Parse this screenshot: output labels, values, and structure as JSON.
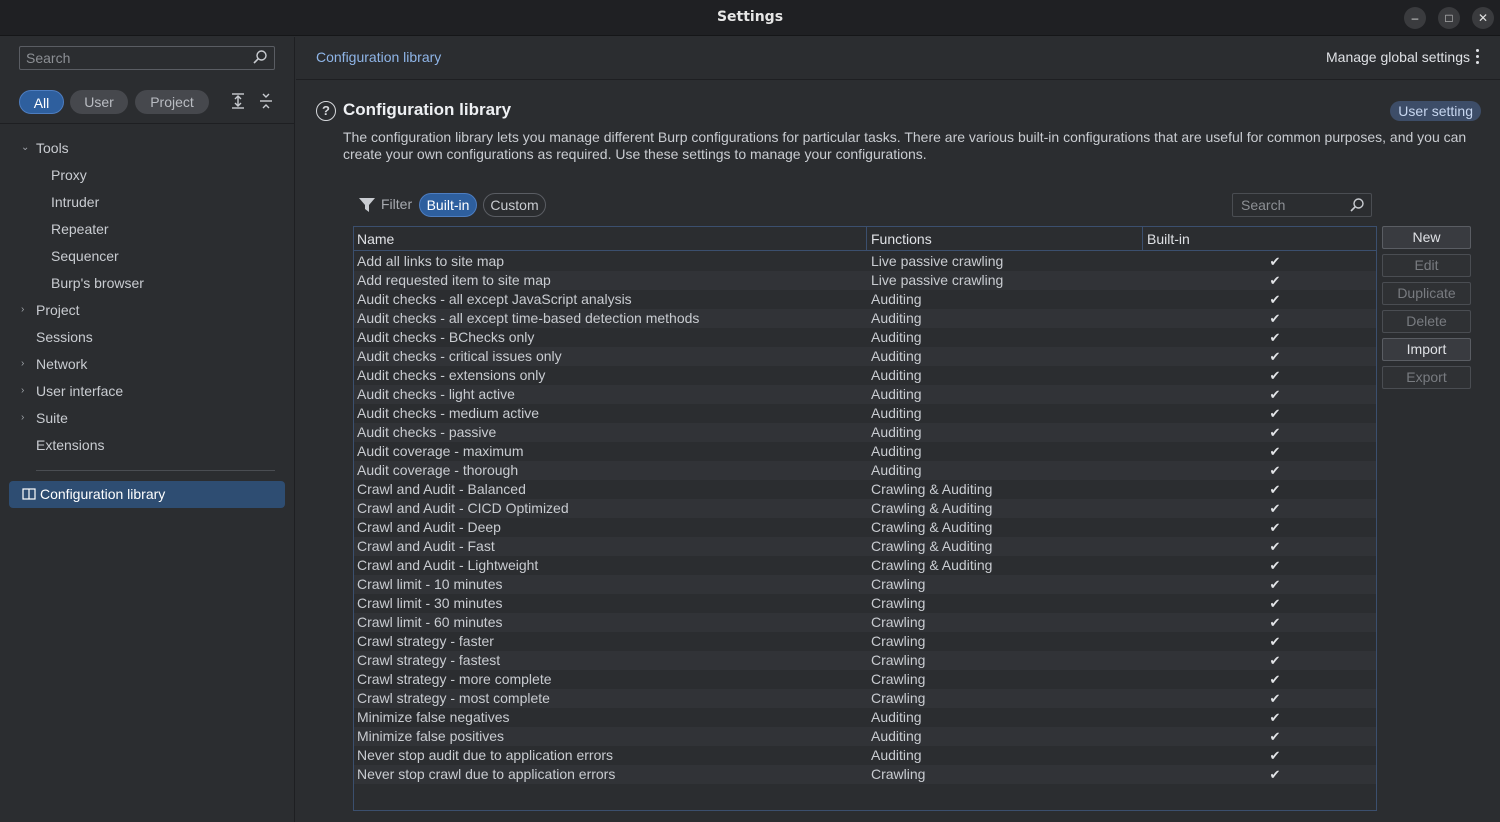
{
  "window": {
    "title": "Settings"
  },
  "sidebar": {
    "search_placeholder": "Search",
    "filters": {
      "all": "All",
      "user": "User",
      "project": "Project"
    },
    "tree": [
      {
        "label": "Tools",
        "expanded": true
      },
      {
        "label": "Proxy"
      },
      {
        "label": "Intruder"
      },
      {
        "label": "Repeater"
      },
      {
        "label": "Sequencer"
      },
      {
        "label": "Burp's browser"
      },
      {
        "label": "Project",
        "expandable": true
      },
      {
        "label": "Sessions"
      },
      {
        "label": "Network",
        "expandable": true
      },
      {
        "label": "User interface",
        "expandable": true
      },
      {
        "label": "Suite",
        "expandable": true
      },
      {
        "label": "Extensions"
      }
    ],
    "selected": "Configuration library"
  },
  "header": {
    "breadcrumb": "Configuration library",
    "manage_global": "Manage global settings"
  },
  "section": {
    "title": "Configuration library",
    "badge": "User setting",
    "description": "The configuration library lets you manage different Burp configurations for particular tasks. There are various built-in configurations that are useful for common purposes, and you can create your own configurations as required. Use these settings to manage your configurations."
  },
  "filter": {
    "label": "Filter",
    "builtin": "Built-in",
    "custom": "Custom",
    "search_placeholder": "Search"
  },
  "table": {
    "columns": [
      "Name",
      "Functions",
      "Built-in"
    ],
    "check": "✔",
    "rows": [
      [
        "Add all links to site map",
        "Live passive crawling"
      ],
      [
        "Add requested item to site map",
        "Live passive crawling"
      ],
      [
        "Audit checks - all except JavaScript analysis",
        "Auditing"
      ],
      [
        "Audit checks - all except time-based detection methods",
        "Auditing"
      ],
      [
        "Audit checks - BChecks only",
        "Auditing"
      ],
      [
        "Audit checks - critical issues only",
        "Auditing"
      ],
      [
        "Audit checks - extensions only",
        "Auditing"
      ],
      [
        "Audit checks - light active",
        "Auditing"
      ],
      [
        "Audit checks - medium active",
        "Auditing"
      ],
      [
        "Audit checks - passive",
        "Auditing"
      ],
      [
        "Audit coverage - maximum",
        "Auditing"
      ],
      [
        "Audit coverage - thorough",
        "Auditing"
      ],
      [
        "Crawl and Audit - Balanced",
        "Crawling & Auditing"
      ],
      [
        "Crawl and Audit - CICD Optimized",
        "Crawling & Auditing"
      ],
      [
        "Crawl and Audit - Deep",
        "Crawling & Auditing"
      ],
      [
        "Crawl and Audit - Fast",
        "Crawling & Auditing"
      ],
      [
        "Crawl and Audit - Lightweight",
        "Crawling & Auditing"
      ],
      [
        "Crawl limit - 10 minutes",
        "Crawling"
      ],
      [
        "Crawl limit - 30 minutes",
        "Crawling"
      ],
      [
        "Crawl limit - 60 minutes",
        "Crawling"
      ],
      [
        "Crawl strategy - faster",
        "Crawling"
      ],
      [
        "Crawl strategy - fastest",
        "Crawling"
      ],
      [
        "Crawl strategy - more complete",
        "Crawling"
      ],
      [
        "Crawl strategy - most complete",
        "Crawling"
      ],
      [
        "Minimize false negatives",
        "Auditing"
      ],
      [
        "Minimize false positives",
        "Auditing"
      ],
      [
        "Never stop audit due to application errors",
        "Auditing"
      ],
      [
        "Never stop crawl due to application errors",
        "Crawling"
      ]
    ]
  },
  "actions": {
    "new": "New",
    "edit": "Edit",
    "duplicate": "Duplicate",
    "delete": "Delete",
    "import": "Import",
    "export": "Export"
  },
  "colors": {
    "accent": "#2e5f9e",
    "selected_item": "#2e4d72",
    "link": "#8fb5e8"
  }
}
